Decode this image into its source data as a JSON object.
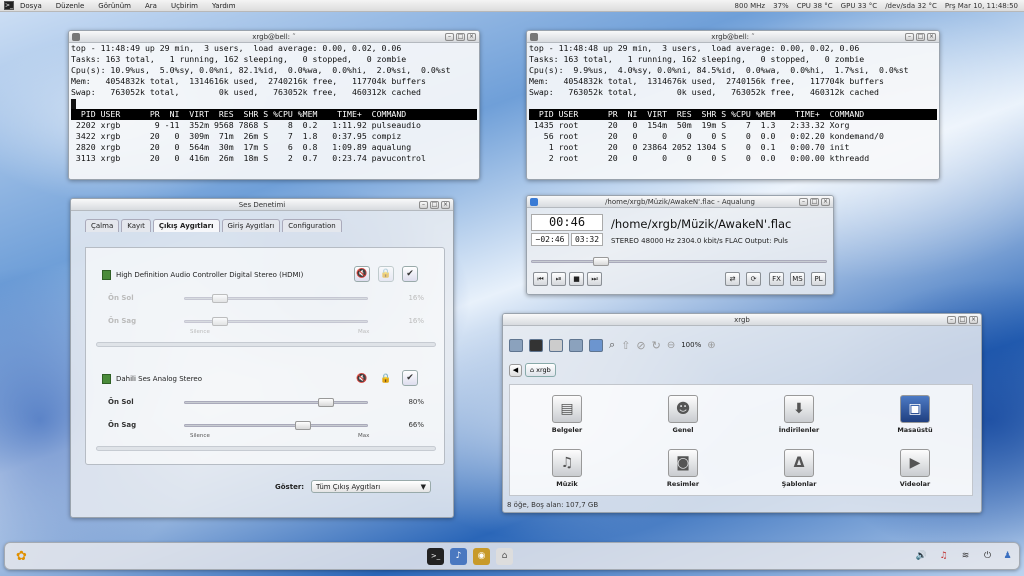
{
  "topbar": {
    "menus": [
      "Dosya",
      "Düzenle",
      "Görünüm",
      "Ara",
      "Uçbirim",
      "Yardım"
    ],
    "status": [
      "800 MHz",
      "37%",
      "CPU 38 °C",
      "GPU 33 °C",
      "/dev/sda 32 °C",
      "Prş Mar 10, 11:48:50"
    ]
  },
  "term1": {
    "title": "xrgb@bell: ˜",
    "lines": [
      "top - 11:48:49 up 29 min,  3 users,  load average: 0.00, 0.02, 0.06",
      "Tasks: 163 total,   1 running, 162 sleeping,   0 stopped,   0 zombie",
      "Cpu(s): 10.9%us,  5.0%sy, 0.0%ni, 82.1%id,  0.0%wa,  0.0%hi,  2.0%si,  0.0%st",
      "Mem:   4054832k total,  1314616k used,  2740216k free,   117704k buffers",
      "Swap:   763052k total,        0k used,   763052k free,   460312k cached"
    ],
    "header": "  PID USER      PR  NI  VIRT  RES  SHR S %CPU %MEM    TIME+  COMMAND",
    "rows": [
      " 2202 xrgb       9 -11  352m 9568 7868 S    8  0.2   1:11.92 pulseaudio",
      " 3422 xrgb      20   0  309m  71m  26m S    7  1.8   0:37.95 compiz",
      " 2820 xrgb      20   0  564m  30m  17m S    6  0.8   1:09.89 aqualung",
      " 3113 xrgb      20   0  416m  26m  18m S    2  0.7   0:23.74 pavucontrol"
    ]
  },
  "term2": {
    "title": "xrgb@bell: ˜",
    "lines": [
      "top - 11:48:48 up 29 min,  3 users,  load average: 0.00, 0.02, 0.06",
      "Tasks: 163 total,   1 running, 162 sleeping,   0 stopped,   0 zombie",
      "Cpu(s):  9.9%us,  4.0%sy, 0.0%ni, 84.5%id,  0.0%wa,  0.0%hi,  1.7%si,  0.0%st",
      "Mem:   4054832k total,  1314676k used,  2740156k free,   117704k buffers",
      "Swap:   763052k total,        0k used,   763052k free,   460312k cached"
    ],
    "header": "  PID USER      PR  NI  VIRT  RES  SHR S %CPU %MEM    TIME+  COMMAND",
    "rows": [
      " 1435 root      20   0  154m  50m  19m S    7  1.3   2:33.32 Xorg",
      "   56 root      20   0     0    0    0 S    0  0.0   0:02.20 kondemand/0",
      "    1 root      20   0 23864 2052 1304 S    0  0.1   0:00.70 init",
      "    2 root      20   0     0    0    0 S    0  0.0   0:00.00 kthreadd"
    ]
  },
  "sound": {
    "title": "Ses Denetimi",
    "tabs": [
      "Çalma",
      "Kayıt",
      "Çıkış Aygıtları",
      "Giriş Aygıtları",
      "Configuration"
    ],
    "device1": {
      "name": "High Definition Audio Controller Digital Stereo (HDMI)",
      "left_label": "Ön Sol",
      "right_label": "Ön Sag",
      "left_pct": "16%",
      "right_pct": "16%",
      "left_level": 0.16,
      "right_level": 0.16,
      "silence": "Silence",
      "max": "Max"
    },
    "device2": {
      "name": "Dahili Ses Analog Stereo",
      "left_label": "Ön Sol",
      "right_label": "Ön Sag",
      "left_pct": "80%",
      "right_pct": "66%",
      "left_level": 0.8,
      "right_level": 0.66,
      "silence": "Silence",
      "max": "Max"
    },
    "show_label": "Göster:",
    "show_value": "Tüm Çıkış Aygıtları"
  },
  "aqualung": {
    "title": "/home/xrgb/Müzik/AwakeN'.flac - Aqualung",
    "elapsed": "00:46",
    "remaining": "−02:46",
    "total": "03:32",
    "track": "/home/xrgb/Müzik/AwakeN'.flac",
    "info": "STEREO 48000 Hz  2304.0 kbit/s  FLAC   Output: Puls",
    "position": 0.22,
    "buttons": [
      "⏮",
      "⏯",
      "■",
      "⏭"
    ],
    "mode_buttons": [
      "⇄",
      "⟳",
      "FX",
      "MS",
      "PL"
    ]
  },
  "filemanager": {
    "title": "xrgb",
    "zoom": "100%",
    "crumb": "xrgb",
    "items": [
      "Belgeler",
      "Genel",
      "İndirilenler",
      "Masaüstü",
      "Müzik",
      "Resimler",
      "Şablonlar",
      "Videolar"
    ],
    "icons": [
      "▤",
      "☻",
      "⬇",
      "▣",
      "♫",
      "◙",
      "Δ",
      "▶"
    ],
    "status": "8 öğe, Boş alan: 107,7 GB"
  }
}
